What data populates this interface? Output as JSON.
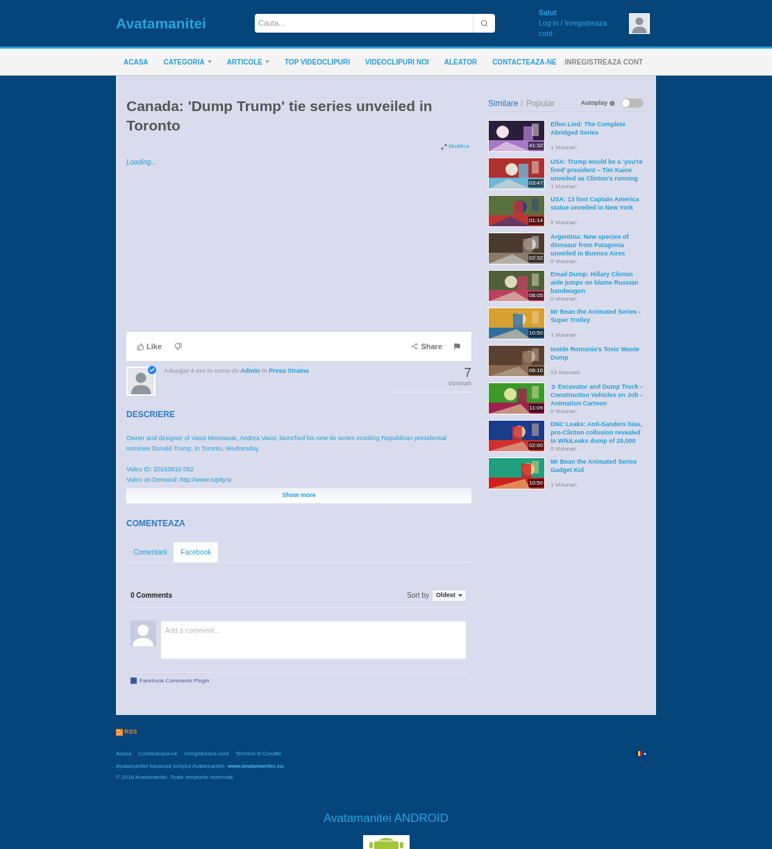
{
  "header": {
    "logo": "Avatamanitei",
    "search": {
      "placeholder": "Cauta..."
    },
    "greeting": "Salut",
    "login": "Log in / Inregistreaza cont"
  },
  "nav": {
    "items": [
      {
        "label": "ACASA",
        "dropdown": false
      },
      {
        "label": "CATEGORIA",
        "dropdown": true
      },
      {
        "label": "ARTICOLE",
        "dropdown": true
      },
      {
        "label": "TOP VIDEOCLIPURI",
        "dropdown": false
      },
      {
        "label": "VIDEOCLIPURI NOI",
        "dropdown": false
      },
      {
        "label": "ALEATOR",
        "dropdown": false
      },
      {
        "label": "CONTACTEAZA-NE",
        "dropdown": false
      }
    ],
    "register": "INREGISTREAZA CONT"
  },
  "video": {
    "title": "Canada: 'Dump Trump' tie series unveiled in Toronto",
    "edit": "Modifica",
    "loading": "Loading...",
    "actions": {
      "like": "Like",
      "share": "Share"
    },
    "meta": {
      "added": "Adaugat 4 ore in urma de",
      "author": "Admin",
      "in": "in",
      "category": "Presa Straina",
      "verified": true
    },
    "views": {
      "count": "7",
      "label": "vizionari"
    }
  },
  "description": {
    "heading": "DESCRIERE",
    "paragraphs": [
      "Owner and designer of Vassi Menswear, Andrea Vassi, launched his new tie series mocking Republican presidential nominee Donald Trump, in Toronto, Wednesday.",
      "Video ID: 20160810 052",
      "Video on Demand: http://www.ruptly.tv"
    ],
    "show_more": "Show more"
  },
  "comments": {
    "heading": "COMENTEAZA",
    "tabs": [
      {
        "label": "Comentarii",
        "selected": false
      },
      {
        "label": "Facebook",
        "selected": true
      }
    ],
    "count": "0 Comments",
    "sort_label": "Sort by",
    "sort_value": "Oldest",
    "placeholder": "Add a comment...",
    "plugin": "Facebook Comments Plugin"
  },
  "sidebar": {
    "tabs": [
      {
        "label": "Similare",
        "selected": true
      },
      {
        "label": "Popular",
        "selected": false
      }
    ],
    "separator": "/",
    "autoplay": {
      "label": "Autoplay",
      "on": false
    },
    "videos": [
      {
        "title": "Elfen Lied: The Complete Abridged Series",
        "duration": "41:32",
        "views": "1 Vizionari"
      },
      {
        "title": "USA: Trump would be a ‘you're fired’ president – Tim Kaine unveiled as Clinton's running",
        "duration": "03:47",
        "views": "1 Vizionari"
      },
      {
        "title": "USA: 13 foot Captain America statue unveiled in New York",
        "duration": "01:14",
        "views": "2 Vizionari"
      },
      {
        "title": "Argentina: New species of dinosaur from Patagonia unveiled in Buenos Aires",
        "duration": "02:32",
        "views": "0 Vizionari"
      },
      {
        "title": "Email Dump: Hillary Clinton aide jumps on blame Russian bandwagon",
        "duration": "08:05",
        "views": "0 Vizionari"
      },
      {
        "title": "Mr Bean the Animated Series - Super Trolley",
        "duration": "10:50",
        "views": "1 Vizionari"
      },
      {
        "title": "Inside Romania's Toxic Waste Dump",
        "duration": "06:16",
        "views": "23 Vizionari"
      },
      {
        "title": "➲ Excavator and Dump Truck - Construction Vehicles on Job - Animation Cartoon",
        "duration": "11:09",
        "views": "0 Vizionari"
      },
      {
        "title": "DNC Leaks: Anti-Sanders bias, pro-Clinton collusion revealed in WikiLeaks dump of 20,000",
        "duration": "02:00",
        "views": "0 Vizionari"
      },
      {
        "title": "Mr Bean the Animated Series Gadget Kid",
        "duration": "10:50",
        "views": "1 Vizionari"
      }
    ]
  },
  "footer": {
    "rss": "RSS",
    "links": [
      "Acasa",
      "Contacteaza-ne",
      "Inregistreaza cont",
      "Termeni si Conditii"
    ],
    "script_note": "Avatamanitei foloseste scriptul Avatamanitei- **www.avatamanitei.eu**.",
    "copyright": "© 2016 Avatamanitei. Toate drepturile rezervate",
    "android": "Avatamanitei ANDROID"
  }
}
